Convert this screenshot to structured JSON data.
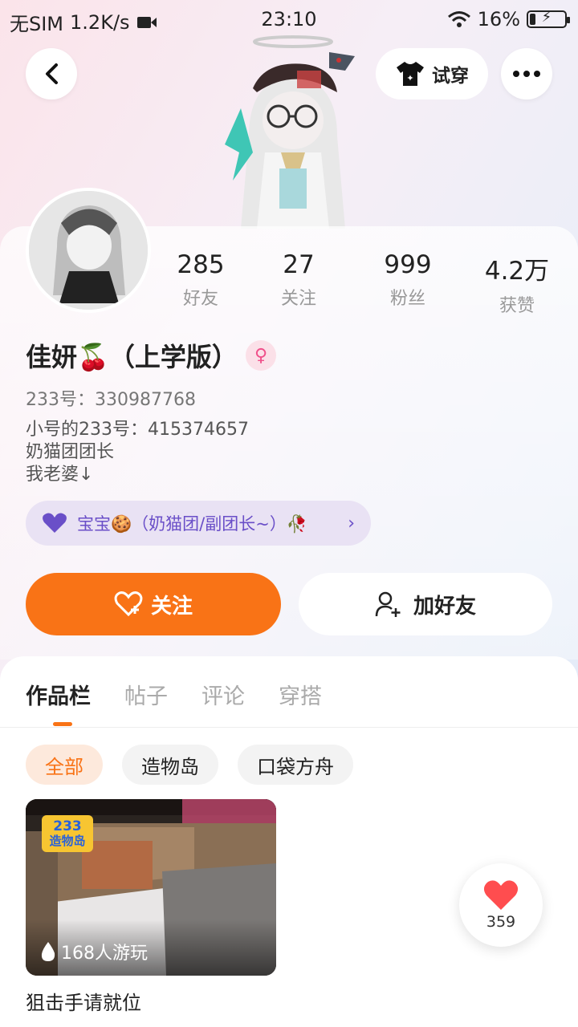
{
  "status_bar": {
    "carrier": "无SIM",
    "speed": "1.2K/s",
    "time": "23:10",
    "battery": "16%"
  },
  "header": {
    "try_on_label": "试穿"
  },
  "stats": [
    {
      "value": "285",
      "label": "好友"
    },
    {
      "value": "27",
      "label": "关注"
    },
    {
      "value": "999",
      "label": "粉丝"
    },
    {
      "value": "4.2万",
      "label": "获赞"
    }
  ],
  "profile": {
    "nickname": "佳妍🍒（上学版）",
    "uid": "233号：330987768",
    "bio_lines": [
      "小号的233号：415374657",
      "奶猫团团长",
      "我老婆↓"
    ]
  },
  "relation_tag": {
    "text": "宝宝🍪（奶猫团/副团长~）🥀"
  },
  "actions": {
    "follow": "关注",
    "add_friend": "加好友"
  },
  "tabs": [
    "作品栏",
    "帖子",
    "评论",
    "穿搭"
  ],
  "filters": [
    "全部",
    "造物岛",
    "口袋方舟"
  ],
  "game": {
    "badge_top": "233",
    "badge_bottom": "造物岛",
    "plays": "168人游玩",
    "title": "狙击手请就位"
  },
  "like": {
    "count": "359"
  },
  "colors": {
    "accent": "#f97316",
    "relation": "#6a4fc8",
    "gender": "#f0508a"
  }
}
